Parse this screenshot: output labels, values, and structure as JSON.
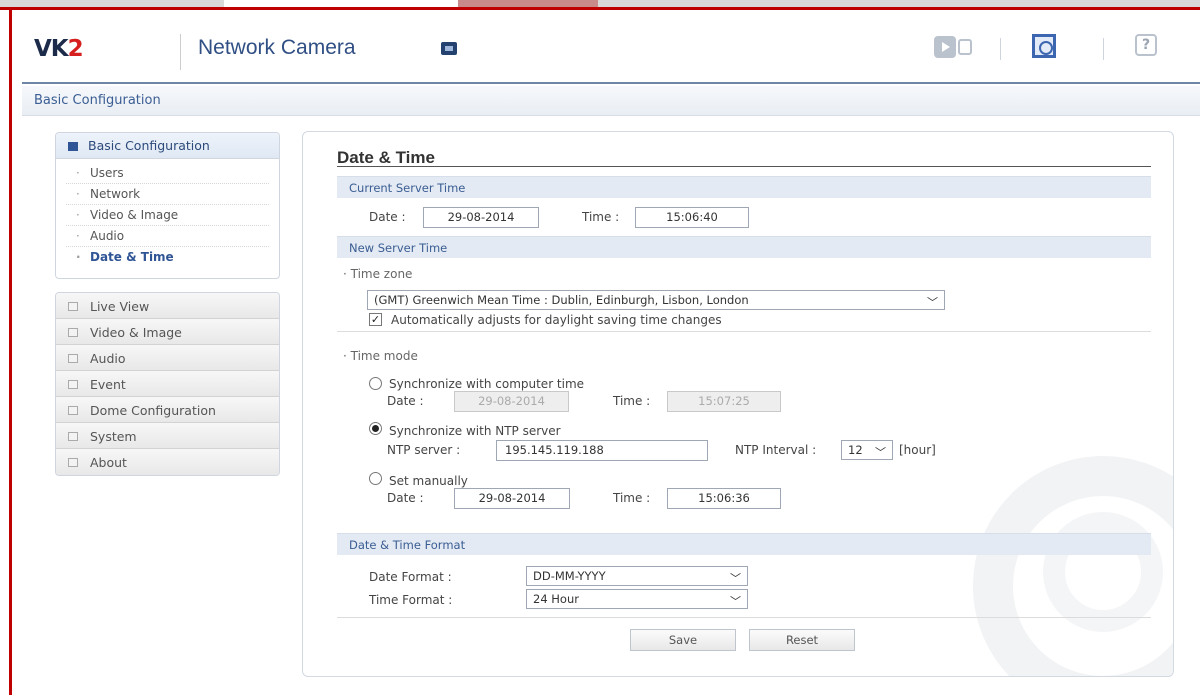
{
  "header": {
    "logo_main": "VK",
    "logo_accent": "2",
    "product": "Network Camera",
    "icons": [
      "camera-icon",
      "live-view-icon",
      "setup-icon",
      "help-icon"
    ],
    "help_glyph": "?"
  },
  "breadcrumb": "Basic Configuration",
  "sidebar": {
    "group_title": "Basic Configuration",
    "items": [
      {
        "label": "Users"
      },
      {
        "label": "Network"
      },
      {
        "label": "Video & Image"
      },
      {
        "label": "Audio"
      },
      {
        "label": "Date & Time",
        "active": true
      }
    ],
    "menu": [
      {
        "label": "Live View"
      },
      {
        "label": "Video & Image"
      },
      {
        "label": "Audio"
      },
      {
        "label": "Event"
      },
      {
        "label": "Dome Configuration"
      },
      {
        "label": "System"
      },
      {
        "label": "About"
      }
    ]
  },
  "main": {
    "title": "Date & Time",
    "current": {
      "section": "Current Server Time",
      "date_label": "Date :",
      "date_value": "29-08-2014",
      "time_label": "Time :",
      "time_value": "15:06:40"
    },
    "new": {
      "section": "New Server Time",
      "timezone_label": "· Time zone",
      "timezone_value": "(GMT) Greenwich Mean Time : Dublin, Edinburgh, Lisbon, London",
      "dst_label": "Automatically adjusts for daylight saving time changes",
      "dst_checked": true,
      "mode_label": "· Time mode",
      "sync_pc_label": "Synchronize with computer time",
      "sync_pc_date_label": "Date :",
      "sync_pc_date": "29-08-2014",
      "sync_pc_time_label": "Time :",
      "sync_pc_time": "15:07:25",
      "ntp_label": "Synchronize with NTP server",
      "ntp_server_label": "NTP server :",
      "ntp_server_value": "195.145.119.188",
      "ntp_interval_label": "NTP Interval :",
      "ntp_interval_value": "12",
      "ntp_interval_unit": "[hour]",
      "manual_label": "Set manually",
      "manual_date_label": "Date :",
      "manual_date": "29-08-2014",
      "manual_time_label": "Time :",
      "manual_time": "15:06:36",
      "selected_mode": "ntp"
    },
    "format": {
      "section": "Date & Time Format",
      "date_format_label": "Date Format :",
      "date_format_value": "DD-MM-YYYY",
      "time_format_label": "Time Format :",
      "time_format_value": "24 Hour"
    },
    "buttons": {
      "save": "Save",
      "reset": "Reset"
    }
  }
}
